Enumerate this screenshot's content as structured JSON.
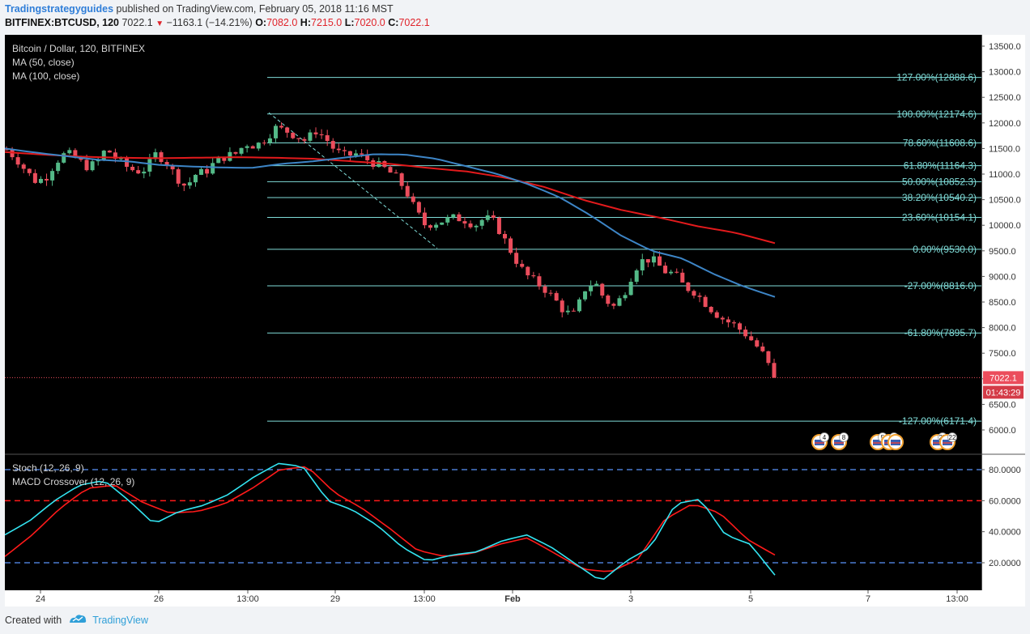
{
  "header": {
    "author": "Tradingstrategyguides",
    "published": "published on TradingView.com, February 05, 2018 11:16 MST",
    "symbol": "BITFINEX:BTCUSD, 120",
    "last": "7022.1",
    "change": "−1163.1 (−14.21%)",
    "o_label": "O:",
    "o_value": "7082.0",
    "h_label": "H:",
    "h_value": "7215.0",
    "l_label": "L:",
    "l_value": "7020.0",
    "c_label": "C:",
    "c_value": "7022.1"
  },
  "legend": {
    "title": "Bitcoin / Dollar, 120, BITFINEX",
    "ma50": "MA (50, close)",
    "ma100": "MA (100, close)",
    "stoch": "Stoch (12, 26, 9)",
    "macd": "MACD Crossover (12, 26, 9)"
  },
  "price_badge": {
    "value": "7022.1",
    "countdown": "01:43:29"
  },
  "footer": {
    "created_with": "Created with",
    "brand": "TradingView"
  },
  "colors": {
    "up": "#53b987",
    "down": "#eb4d5c",
    "fib": "#7fdcd8",
    "ma50": "#3d85c6",
    "ma100": "#e31a1c",
    "stoch_k": "#33e5f2",
    "stoch_d": "#ff1a1a",
    "band": "#4a7bd0"
  },
  "chart_data": [
    {
      "type": "candlestick",
      "title": "Bitcoin / Dollar, 120, BITFINEX",
      "ylim": [
        5700,
        13750
      ],
      "y_ticks": [
        "13500.0",
        "13000.0",
        "12500.0",
        "12000.0",
        "11500.0",
        "11000.0",
        "10500.0",
        "10000.0",
        "9500.0",
        "9000.0",
        "8500.0",
        "8000.0",
        "7500.0",
        "7000.0",
        "6500.0",
        "6000.0"
      ],
      "x_ticks": [
        "24",
        "26",
        "13:00",
        "29",
        "13:00",
        "Feb",
        "3",
        "5",
        "7",
        "13:00"
      ],
      "fib_levels": [
        {
          "label": "127.00%(12888.6)",
          "price": 12888.6
        },
        {
          "label": "100.00%(12174.6)",
          "price": 12174.6
        },
        {
          "label": "78.60%(11608.6)",
          "price": 11608.6
        },
        {
          "label": "61.80%(11164.3)",
          "price": 11164.3
        },
        {
          "label": "50.00%(10852.3)",
          "price": 10852.3
        },
        {
          "label": "38.20%(10540.2)",
          "price": 10540.2
        },
        {
          "label": "23.60%(10154.1)",
          "price": 10154.1
        },
        {
          "label": "0.00%(9530.0)",
          "price": 9530.0
        },
        {
          "label": "-27.00%(8816.0)",
          "price": 8816.0
        },
        {
          "label": "-61.80%(7895.7)",
          "price": 7895.7
        },
        {
          "label": "-127.00%(6171.4)",
          "price": 6171.4
        }
      ],
      "trend_line": {
        "from_price": 12200,
        "to_price": 9550
      },
      "last_price": 7022.1,
      "close_path": [
        11480,
        11300,
        11050,
        10850,
        10950,
        11250,
        11420,
        11300,
        11150,
        11200,
        11500,
        11300,
        11150,
        11050,
        11100,
        11400,
        11250,
        10950,
        10750,
        11000,
        11050,
        11250,
        11350,
        11400,
        11600,
        11550,
        11700,
        11900,
        11850,
        11750,
        11650,
        11850,
        11700,
        11450,
        11350,
        11400,
        11300,
        11200,
        11100,
        10950,
        10700,
        10300,
        10000,
        10050,
        10100,
        10150,
        10100,
        10000,
        10150,
        10050,
        9700,
        9350,
        9050,
        8900,
        8750,
        8550,
        8300,
        8250,
        8750,
        8900,
        8550,
        8400,
        8700,
        9150,
        9350,
        9300,
        9100,
        9050,
        8800,
        8700,
        8500,
        8300,
        8150,
        8050,
        7900,
        7700,
        7450,
        7022
      ],
      "ma50_path": [
        11500,
        11420,
        11350,
        11280,
        11250,
        11180,
        11150,
        11130,
        11120,
        11200,
        11250,
        11320,
        11390,
        11380,
        11300,
        11150,
        11000,
        10800,
        10550,
        10200,
        9800,
        9500,
        9350,
        9050,
        8800,
        8600
      ],
      "ma100_path": [
        11430,
        11380,
        11340,
        11320,
        11310,
        11320,
        11330,
        11320,
        11300,
        11250,
        11200,
        11120,
        11050,
        10930,
        10750,
        10500,
        10300,
        10150,
        9980,
        9850,
        9650
      ]
    },
    {
      "type": "line",
      "title": "Stoch (12, 26, 9)",
      "subtitle": "MACD Crossover (12, 26, 9)",
      "ylim": [
        10,
        90
      ],
      "y_ticks": [
        "80.0000",
        "60.0000",
        "40.0000",
        "20.0000"
      ],
      "bands": [
        80,
        60,
        20
      ],
      "series": [
        {
          "values": [
            38,
            47,
            60,
            70,
            73,
            60,
            45,
            53,
            57,
            64,
            75,
            84,
            82,
            60,
            54,
            44,
            30,
            21,
            25,
            27,
            34,
            38,
            30,
            19,
            8,
            21,
            30,
            58,
            61,
            38,
            32,
            12
          ]
        },
        {
          "values": [
            24,
            38,
            55,
            68,
            70,
            59,
            52,
            53,
            58,
            68,
            80,
            82,
            65,
            55,
            42,
            28,
            24,
            26,
            32,
            36,
            26,
            16,
            14,
            22,
            48,
            58,
            52,
            35,
            25
          ]
        }
      ]
    }
  ]
}
